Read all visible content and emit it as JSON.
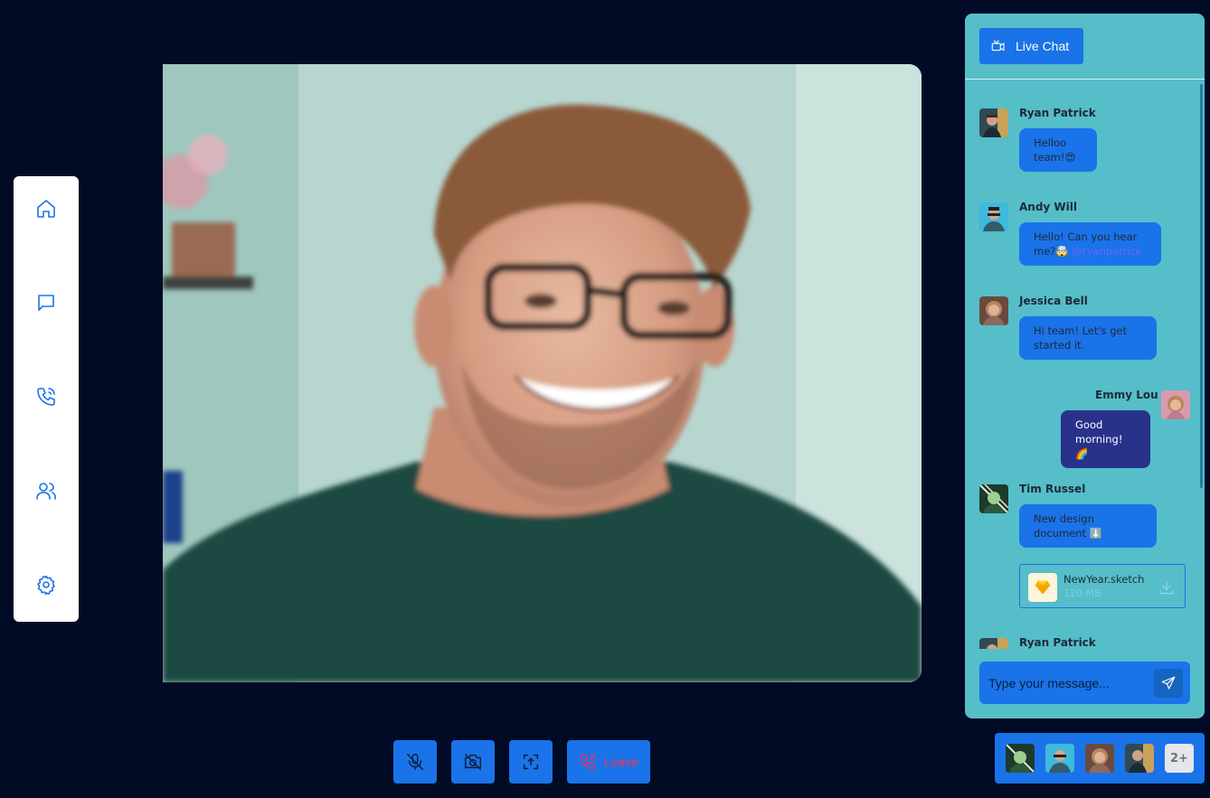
{
  "sidebar": {
    "items": [
      {
        "name": "home",
        "icon": "home-icon"
      },
      {
        "name": "messages",
        "icon": "chat-bubble-icon"
      },
      {
        "name": "calls",
        "icon": "phone-call-icon"
      },
      {
        "name": "people",
        "icon": "users-icon"
      },
      {
        "name": "settings",
        "icon": "gear-icon"
      }
    ]
  },
  "controls": {
    "mute_icon": "mic-off-icon",
    "camera_icon": "camera-off-icon",
    "share_icon": "screen-share-icon",
    "leave_label": "Leave",
    "leave_icon": "phone-x-icon"
  },
  "chat": {
    "header_label": "Live Chat",
    "header_icon": "video-camera-icon",
    "messages": [
      {
        "sender": "Ryan Patrick",
        "lines": [
          "Helloo",
          "team!😍"
        ]
      },
      {
        "sender": "Andy Will",
        "lines": [
          "Hello! Can you hear",
          "me?🤯"
        ],
        "mention": "@ryanpatrick"
      },
      {
        "sender": "Jessica Bell",
        "lines": [
          "Hi team! Let's get",
          "started it."
        ]
      },
      {
        "sender": "Emmy Lou",
        "lines": [
          "Good",
          "morning! 🌈"
        ]
      },
      {
        "sender": "Tim Russel",
        "lines": [
          "New design",
          "document ⬇️"
        ]
      },
      {
        "sender": "Ryan Patrick",
        "lines": []
      }
    ],
    "file": {
      "name": "NewYear.sketch",
      "size": "120 MB",
      "icon": "sketch-diamond-icon"
    },
    "input_placeholder": "Type your message...",
    "send_icon": "send-icon"
  },
  "participants": {
    "more_label": "2+"
  },
  "colors": {
    "background": "#020b26",
    "accent": "#1a73e8",
    "chat_panel": "#55bec9",
    "own_bubble": "#28328a",
    "leave_red": "#ff2d55",
    "mention": "#6c63ff"
  }
}
